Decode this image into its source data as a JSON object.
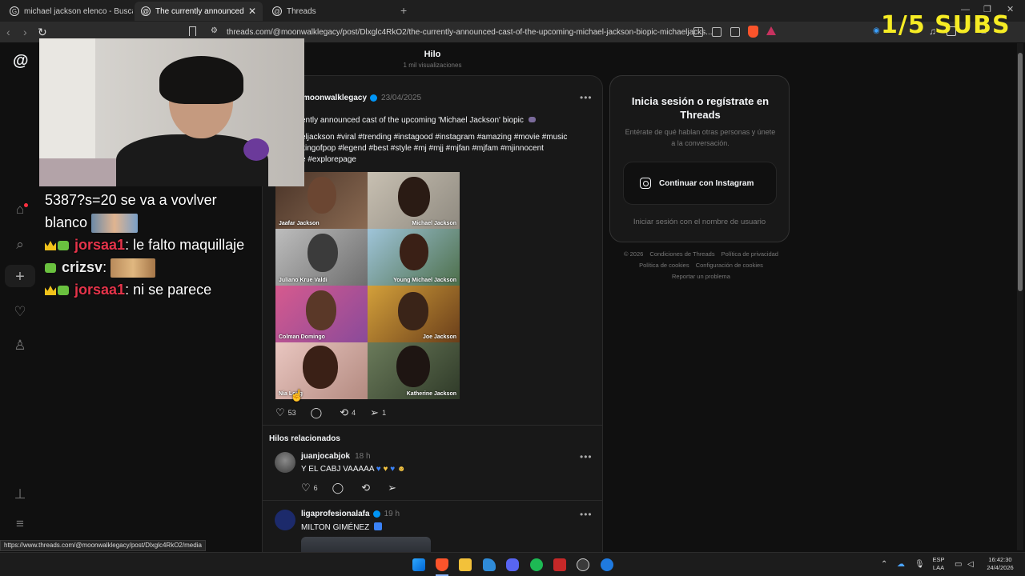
{
  "browser": {
    "tabs": [
      {
        "label": "michael jackson elenco - Buscar con",
        "active": false
      },
      {
        "label": "The currently announced cast of",
        "active": true
      },
      {
        "label": "Threads",
        "active": false
      }
    ],
    "url": "threads.com/@moonwalklegacy/post/Dlxglc4RkO2/the-currently-announced-cast-of-the-upcoming-michael-jackson-biopic-michaeljacks..."
  },
  "stream_overlay": {
    "subs_goal": "1/5 SUBS",
    "chat": [
      {
        "text": "5387?s=20 se va a vovlver",
        "user": ""
      },
      {
        "text": "blanco",
        "user": ""
      },
      {
        "user": "jorsaa1",
        "text": ": le falto maquillaje"
      },
      {
        "user": "crizsv",
        "text": ":"
      },
      {
        "user": "jorsaa1",
        "text": ": ni se parece"
      }
    ]
  },
  "threads": {
    "header_title": "Hilo",
    "header_subtitle": "1 mil visualizaciones",
    "post": {
      "username": "moonwalklegacy",
      "date": "23/04/2025",
      "text": "ently announced cast of the upcoming 'Michael Jackson' biopic",
      "hashtags": [
        "eljackson #viral #trending #instagood #instagram #amazing #movie #music",
        "kingofpop #legend #best #style #mj #mjj #mjfan #mjfam #mjinnocent",
        "e #explorepage"
      ],
      "cast": [
        {
          "name": "Jaafar Jackson"
        },
        {
          "name": "Michael Jackson"
        },
        {
          "name": "Juliano Krue Valdi"
        },
        {
          "name": "Young Michael Jackson"
        },
        {
          "name": "Colman Domingo"
        },
        {
          "name": "Joe Jackson"
        },
        {
          "name": "Nia Long"
        },
        {
          "name": "Katherine Jackson"
        }
      ],
      "likes": "53",
      "reposts": "4",
      "shares": "1"
    },
    "related_title": "Hilos relacionados",
    "related": [
      {
        "username": "juanjocabjok",
        "time": "18 h",
        "text": "Y EL CABJ VAAAAA",
        "likes": "6",
        "verified": false
      },
      {
        "username": "ligaprofesionalafa",
        "time": "19 h",
        "text": "MILTON GIMÉNEZ",
        "verified": true
      }
    ],
    "login_card": {
      "title": "Inicia sesión o regístrate en Threads",
      "description": "Entérate de qué hablan otras personas y únete a la conversación.",
      "instagram_button": "Continuar con Instagram",
      "username_login": "Iniciar sesión con el nombre de usuario"
    },
    "footer": {
      "line1": [
        "© 2026",
        "Condiciones de Threads",
        "Política de privacidad"
      ],
      "line2": [
        "Política de cookies",
        "Configuración de cookies"
      ],
      "line3": [
        "Reportar un problema"
      ]
    }
  },
  "status_url": "https://www.threads.com/@moonwalklegacy/post/Dlxglc4RkO2/media",
  "taskbar": {
    "lang": "ESP",
    "lang_sub": "LAA",
    "time": "16:42:30",
    "date": "24/4/2026"
  }
}
